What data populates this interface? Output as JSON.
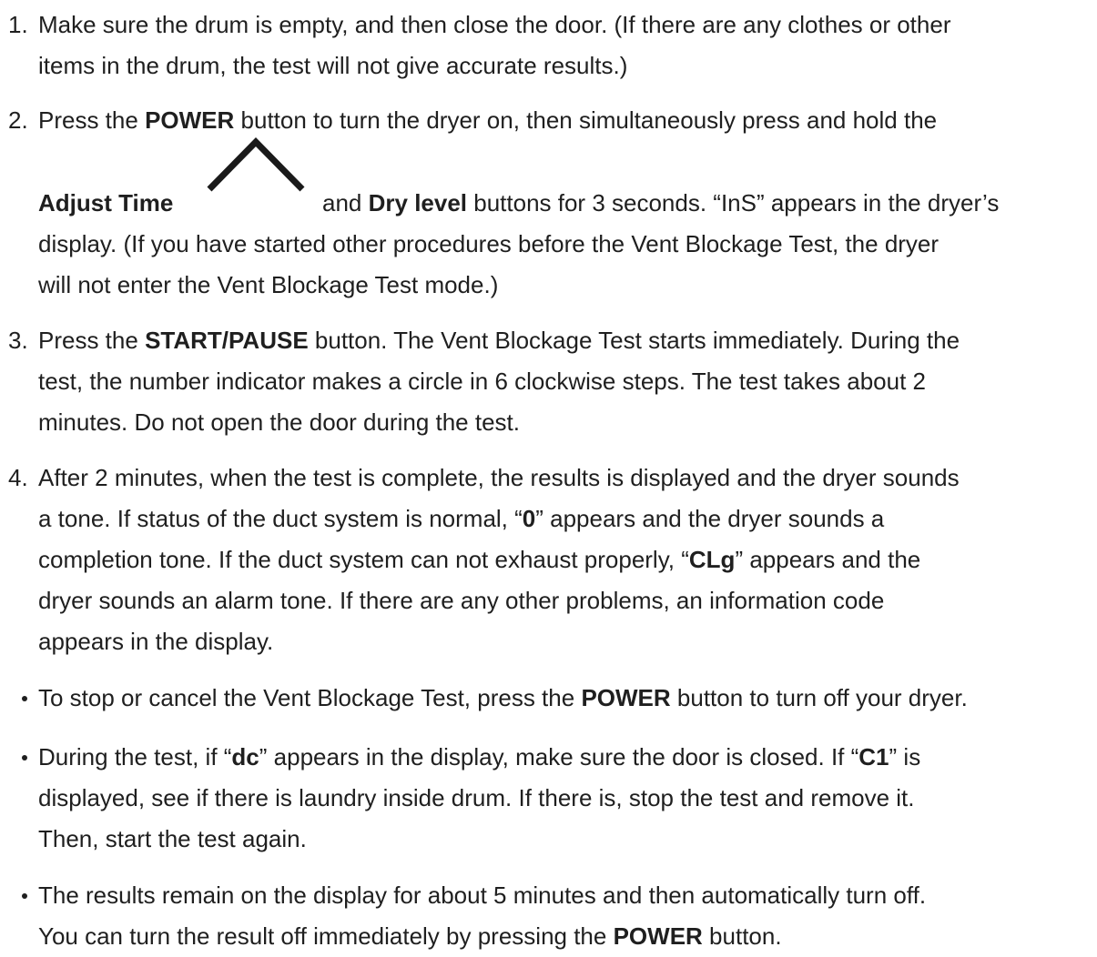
{
  "steps": [
    {
      "number": "1.",
      "lines": [
        [
          "Make sure the drum is empty, and then close the door. (If there are any clothes or other"
        ],
        [
          "items in the drum, the test will not give accurate results.)"
        ]
      ]
    },
    {
      "number": "2.",
      "line1": {
        "a": "Press the ",
        "b": "POWER",
        "c": " button to turn the dryer on, then simultaneously press and hold the"
      },
      "line2": {
        "a": "Adjust Time",
        "b": "and ",
        "c": "Dry level",
        "d": " buttons for 3 seconds. “InS” appears in the dryer’s"
      },
      "line3": "display. (If you have started other procedures before the Vent Blockage Test, the dryer",
      "line4": "will not enter the Vent Blockage Test mode.)",
      "icon": "chevron-up-icon"
    },
    {
      "number": "3.",
      "line1": {
        "a": "Press the ",
        "b": "START/PAUSE",
        "c": " button. The Vent Blockage Test starts immediately. During the"
      },
      "line2": "test, the number indicator makes a circle in 6 clockwise steps. The test takes about 2",
      "line3": "minutes. Do not open the door during the test."
    },
    {
      "number": "4.",
      "line1": "After 2 minutes, when the test is complete, the results is displayed and the dryer sounds",
      "line2": {
        "a": "a tone. If status of the duct system is normal, “",
        "b": "0",
        "c": "” appears and the dryer sounds a"
      },
      "line3": {
        "a": "completion tone. If the duct system can not exhaust properly, “",
        "b": "CLg",
        "c": "” appears and the"
      },
      "line4": "dryer sounds an alarm tone. If there are any other problems, an information code",
      "line5": "appears in the display."
    }
  ],
  "bullets": [
    {
      "line1": {
        "a": "To stop or cancel the Vent Blockage Test, press the ",
        "b": "POWER",
        "c": " button to turn off your dryer."
      }
    },
    {
      "line1": {
        "a": "During the test, if “",
        "b": "dc",
        "c": "” appears in the display, make sure the door is closed. If “",
        "d": "C1",
        "e": "” is"
      },
      "line2": "displayed, see if there is laundry inside drum. If there is, stop the test and remove it.",
      "line3": "Then, start the test again."
    },
    {
      "line1": "The results remain on the display for about 5 minutes and then automatically turn off.",
      "line2": {
        "a": "You can turn the result off immediately by pressing the ",
        "b": "POWER",
        "c": " button."
      }
    }
  ]
}
